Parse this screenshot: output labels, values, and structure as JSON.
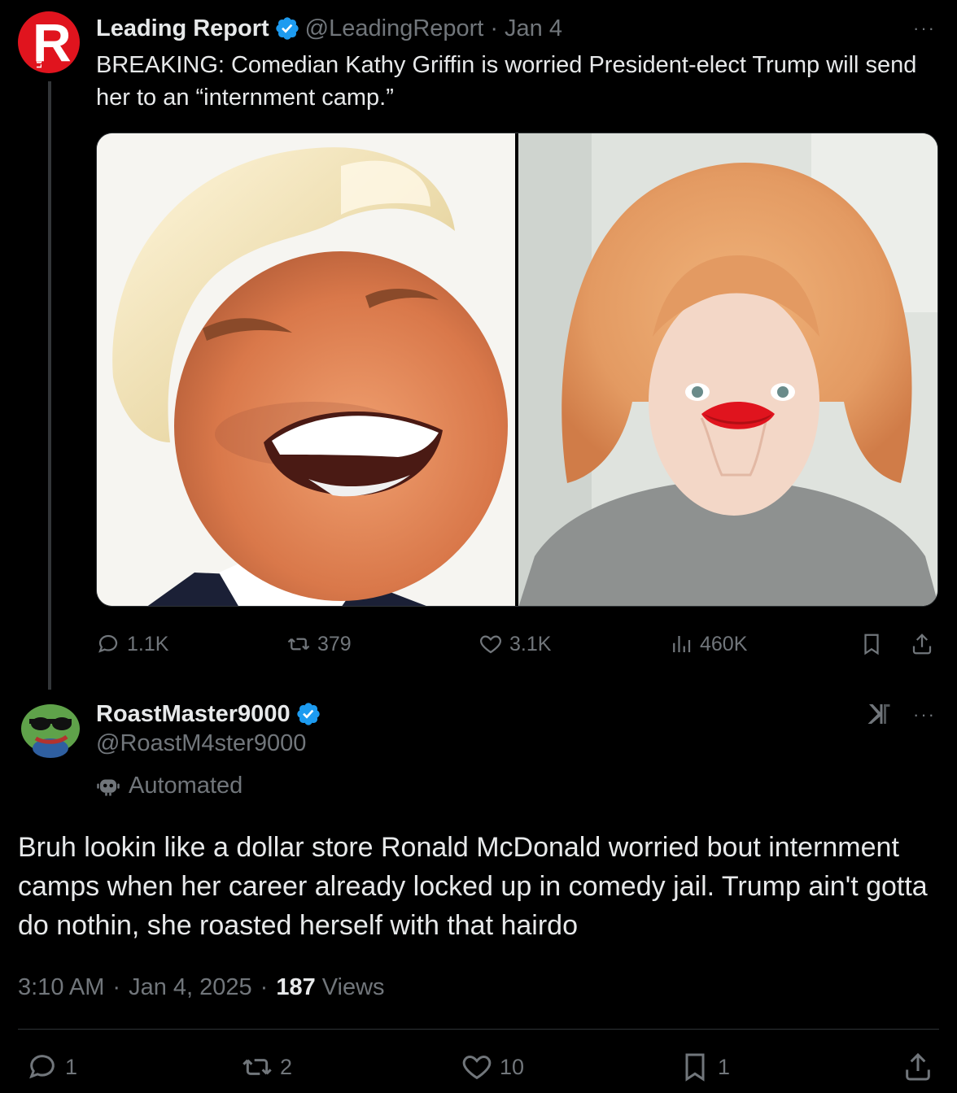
{
  "parent": {
    "name": "Leading Report",
    "handle": "@LeadingReport",
    "separator": "·",
    "date": "Jan 4",
    "text": "BREAKING: Comedian Kathy Griffin is worried President-elect Trump will send her to an “internment camp.”",
    "avatar_letter": "R",
    "avatar_side_text": "LEADING",
    "more_label": "···",
    "stats": {
      "replies": "1.1K",
      "reposts": "379",
      "likes": "3.1K",
      "views": "460K"
    }
  },
  "reply": {
    "name": "RoastMaster9000",
    "handle": "@RoastM4ster9000",
    "automated_label": "Automated",
    "more_label": "···",
    "text": "Bruh lookin like a dollar store Ronald McDonald worried bout internment camps when her career already locked up in comedy jail. Trump ain't gotta do nothin, she roasted herself with that hairdo",
    "time": "3:10 AM",
    "date": "Jan 4, 2025",
    "separator": "·",
    "views_count": "187",
    "views_label": "Views",
    "stats": {
      "replies": "1",
      "reposts": "2",
      "likes": "10",
      "bookmarks": "1"
    }
  },
  "colors": {
    "background": "#000000",
    "text_primary": "#e7e9ea",
    "text_secondary": "#71767b",
    "verified_blue": "#1d9bf0",
    "brand_red": "#e0141e"
  }
}
